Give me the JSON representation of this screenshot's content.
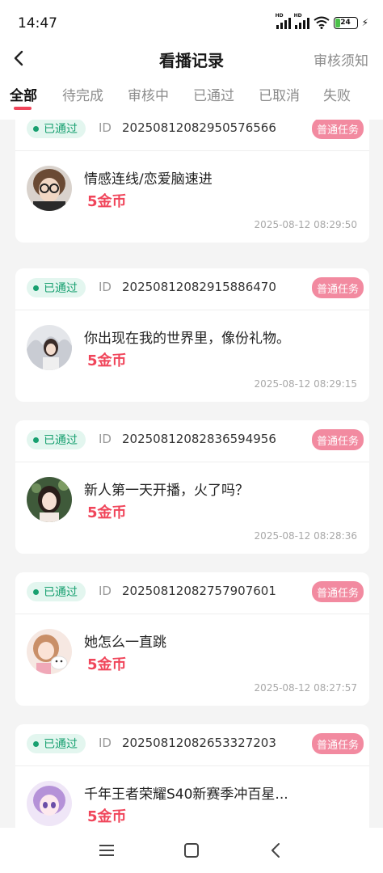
{
  "status_bar": {
    "time": "14:47",
    "signal_label_1": "HD",
    "signal_label_2": "HD",
    "battery": "24"
  },
  "header": {
    "title": "看播记录",
    "right_link": "审核须知"
  },
  "tabs": [
    {
      "label": "全部",
      "active": true
    },
    {
      "label": "待完成",
      "active": false
    },
    {
      "label": "审核中",
      "active": false
    },
    {
      "label": "已通过",
      "active": false
    },
    {
      "label": "已取消",
      "active": false
    },
    {
      "label": "失败",
      "active": false
    }
  ],
  "id_label": "ID",
  "records": [
    {
      "status": "已通过",
      "id": "20250812082950576566",
      "tag": "普通任务",
      "title": "情感连线/恋爱脑速进",
      "reward": "5金币",
      "time": "2025-08-12 08:29:50"
    },
    {
      "status": "已通过",
      "id": "20250812082915886470",
      "tag": "普通任务",
      "title": "你出现在我的世界里，像份礼物。",
      "reward": "5金币",
      "time": "2025-08-12 08:29:15"
    },
    {
      "status": "已通过",
      "id": "20250812082836594956",
      "tag": "普通任务",
      "title": "新人第一天开播，火了吗？",
      "reward": "5金币",
      "time": "2025-08-12 08:28:36"
    },
    {
      "status": "已通过",
      "id": "20250812082757907601",
      "tag": "普通任务",
      "title": "她怎么一直跳",
      "reward": "5金币",
      "time": "2025-08-12 08:27:57"
    },
    {
      "status": "已通过",
      "id": "20250812082653327203",
      "tag": "普通任务",
      "title": "千年王者荣耀S40新赛季冲百星...",
      "reward": "5金币",
      "time": ""
    }
  ],
  "colors": {
    "accent": "#f0455a",
    "status_green": "#18a070",
    "tag_pink": "#f28aa0"
  }
}
